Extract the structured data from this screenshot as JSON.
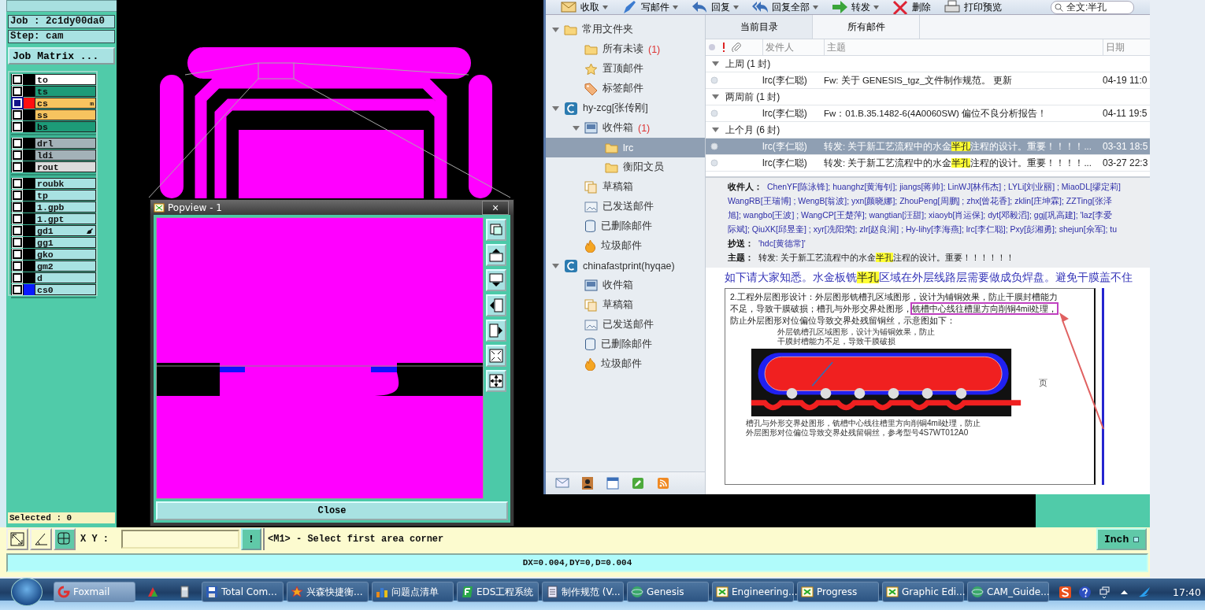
{
  "genesis": {
    "job": "Job : 2c1dy00da0",
    "step": "Step: cam",
    "matrix_button": "Job Matrix ...",
    "layer_groups": [
      {
        "layers": [
          {
            "name": "to",
            "color": "#ffffff",
            "selected": false,
            "flagged": false
          },
          {
            "name": "ts",
            "color": "#1d9b78",
            "selected": false,
            "flagged": false
          },
          {
            "name": "cs",
            "color": "#f7c35f",
            "selected": true,
            "flagged": false,
            "swatch": {
              "color": "#ff1010"
            },
            "mark": "m"
          },
          {
            "name": "ss",
            "color": "#f7c35f",
            "selected": false,
            "flagged": false
          },
          {
            "name": "bs",
            "color": "#1d9b78",
            "selected": false,
            "flagged": false
          }
        ]
      },
      {
        "layers": [
          {
            "name": "drl",
            "color": "#a3b2b8",
            "selected": false,
            "flagged": false
          },
          {
            "name": "ldi",
            "color": "#a3b2b8",
            "selected": false,
            "flagged": false
          },
          {
            "name": "rout",
            "color": "#dcdcdc",
            "selected": false,
            "flagged": false
          }
        ]
      },
      {
        "layers": [
          {
            "name": "roubk",
            "color": "#a8e2e2",
            "selected": false,
            "flagged": false
          },
          {
            "name": "tp",
            "color": "#a8e2e2",
            "selected": false,
            "flagged": false
          },
          {
            "name": "1.gpb",
            "color": "#a8e2e2",
            "selected": false,
            "flagged": false
          },
          {
            "name": "1.gpt",
            "color": "#a8e2e2",
            "selected": false,
            "flagged": false
          },
          {
            "name": "gd1",
            "color": "#a8e2e2",
            "selected": false,
            "flagged": true
          },
          {
            "name": "gg1",
            "color": "#a8e2e2",
            "selected": false,
            "flagged": false
          },
          {
            "name": "gko",
            "color": "#a8e2e2",
            "selected": false,
            "flagged": false
          },
          {
            "name": "gm2",
            "color": "#a8e2e2",
            "selected": false,
            "flagged": false
          },
          {
            "name": "d",
            "color": "#a8e2e2",
            "selected": false,
            "flagged": false
          },
          {
            "name": "cs0",
            "color": "#a8e2e2",
            "selected": false,
            "flagged": false,
            "swatch": {
              "color": "#0a1aff"
            }
          }
        ]
      }
    ],
    "selected_count": "Selected : 0",
    "tool_buttons": [
      {
        "kind": "resize"
      },
      {
        "kind": "measure"
      },
      {
        "kind": "grid"
      }
    ],
    "xy_label": "X Y :",
    "alert_button": "!",
    "prompt": "<M1> - Select first area corner",
    "units": "Inch",
    "status": "DX=0.004,DY=0,D=0.004"
  },
  "popview": {
    "title": "Popview - 1",
    "close_glyph": "×",
    "tools": [
      {
        "kind": "layers"
      },
      {
        "kind": "up"
      },
      {
        "kind": "down"
      },
      {
        "kind": "left"
      },
      {
        "kind": "right"
      },
      {
        "kind": "shrink"
      },
      {
        "kind": "expand"
      }
    ],
    "close_button": "Close"
  },
  "foxmail": {
    "toolbar": [
      {
        "label": "收取",
        "kind": "receive",
        "menu": true
      },
      {
        "label": "写邮件",
        "kind": "compose",
        "menu": true
      },
      {
        "label": "回复",
        "kind": "reply",
        "menu": true
      },
      {
        "label": "回复全部",
        "kind": "reply_all",
        "menu": true
      },
      {
        "label": "转发",
        "kind": "forward",
        "menu": true
      },
      {
        "label": "删除",
        "kind": "delete",
        "menu": false
      },
      {
        "label": "打印预览",
        "kind": "print",
        "menu": false
      }
    ],
    "search": {
      "value": "全文:半孔"
    },
    "folders": [
      {
        "label": "常用文件夹",
        "kind": "folder",
        "selected": false,
        "expanded": true,
        "children": [
          {
            "label": "所有未读",
            "count": "(1)",
            "kind": "folder",
            "selected": false
          },
          {
            "label": "置顶邮件",
            "kind": "star",
            "selected": false
          },
          {
            "label": "标签邮件",
            "kind": "tag",
            "selected": false
          }
        ]
      },
      {
        "label": "hy-zcg[张传刚]",
        "kind": "account",
        "selected": false,
        "expanded": true,
        "children": [
          {
            "label": "收件箱",
            "count": "(1)",
            "kind": "inbox",
            "selected": false,
            "expanded": true,
            "children": [
              {
                "label": "lrc",
                "kind": "folder",
                "selected": true
              },
              {
                "label": "衡阳文员",
                "kind": "folder",
                "selected": false
              }
            ]
          },
          {
            "label": "草稿箱",
            "kind": "drafts",
            "selected": false
          },
          {
            "label": "已发送邮件",
            "kind": "sent",
            "selected": false
          },
          {
            "label": "已删除邮件",
            "kind": "trash",
            "selected": false
          },
          {
            "label": "垃圾邮件",
            "kind": "junk",
            "selected": false
          }
        ]
      },
      {
        "label": "chinafastprint(hyqae)",
        "kind": "account",
        "selected": false,
        "expanded": true,
        "children": [
          {
            "label": "收件箱",
            "kind": "inbox",
            "selected": false
          },
          {
            "label": "草稿箱",
            "kind": "drafts",
            "selected": false
          },
          {
            "label": "已发送邮件",
            "kind": "sent",
            "selected": false
          },
          {
            "label": "已删除邮件",
            "kind": "trash",
            "selected": false
          },
          {
            "label": "垃圾邮件",
            "kind": "junk",
            "selected": false
          }
        ]
      }
    ],
    "bottom_tools": [
      {
        "kind": "mail"
      },
      {
        "kind": "contacts"
      },
      {
        "kind": "calendar"
      },
      {
        "kind": "notes"
      },
      {
        "kind": "rss"
      }
    ],
    "tabs": [
      {
        "label": "当前目录",
        "selected": true
      },
      {
        "label": "所有邮件",
        "selected": false
      }
    ],
    "columns": [
      "发件人",
      "主题",
      "日期"
    ],
    "groups": [
      {
        "label": "上周 (1 封)",
        "expanded": true,
        "messages": [
          {
            "from": "lrc(李仁聪)",
            "subject": [
              {
                "text": "Fw: 关于 GENESIS_tgz_文件制作规范。 更新",
                "highlighted": false
              }
            ],
            "date": "04-19 11:0",
            "selected": false
          }
        ]
      },
      {
        "label": "两周前 (1 封)",
        "expanded": true,
        "messages": [
          {
            "from": "lrc(李仁聪)",
            "subject": [
              {
                "text": "Fw：01.B.35.1482-6(4A0060SW)  偏位不良分析报告！",
                "highlighted": false
              }
            ],
            "date": "04-11 19:5",
            "selected": false
          }
        ]
      },
      {
        "label": "上个月 (6 封)",
        "expanded": true,
        "messages": [
          {
            "from": "lrc(李仁聪)",
            "subject": [
              {
                "text": "转发: 关于新工艺流程中的水金",
                "highlighted": false
              },
              {
                "text": "半孔",
                "highlighted": true
              },
              {
                "text": "注程的设计。重要！！！！...",
                "highlighted": false
              }
            ],
            "date": "03-31 18:5",
            "selected": true
          },
          {
            "from": "lrc(李仁聪)",
            "subject": [
              {
                "text": "转发: 关于新工艺流程中的水金",
                "highlighted": false
              },
              {
                "text": "半孔",
                "highlighted": true
              },
              {
                "text": "注程的设计。重要！！！！...",
                "highlighted": false
              }
            ],
            "date": "03-27 22:3",
            "selected": false
          }
        ]
      }
    ],
    "preview": {
      "to_label": "收件人：",
      "to_lines": [
        "ChenYF[陈泳锋]; huanghz[黄海钊]; jiangs[蒋帅]; LinWJ[林伟杰] ; LYLi[刘业丽] ; MiaoDL[缪定莉]",
        "WangRB[王瑞博] ; WengB[翁波]; yxn[颜晓娜]; ZhouPeng[周鹏] ; zhx[曾花香]; zklin[庄坤霖]; ZZTing[张泽",
        "旭]; wangbo[王波] ; WangCP[王楚萍]; wangtian[汪甜]; xiaoyb[肖运保]; dyt[邓毅滔]; ggj[巩高建]; 'laz[李爱",
        "际斌]; QiuXK[邱昱奎] ; xyr[冼阳荣]; zlr[赵良润] ; Hy-lihy[李海燕]; lrc[李仁聪]; Pxy[彭湘勇]; shejun[佘军]; tu"
      ],
      "cc_label": "抄送：",
      "cc": "'hdc[黄德常]'",
      "subject_label": "主题：",
      "subject": [
        {
          "text": "转发: 关于新工艺流程中的水金",
          "highlighted": false
        },
        {
          "text": "半孔",
          "highlighted": true
        },
        {
          "text": "注程的设计。重要！！！！！！",
          "highlighted": false
        }
      ],
      "intro": [
        {
          "text": "如下请大家知悉。水金板铣",
          "highlighted": false
        },
        {
          "text": "半孔",
          "highlighted": true
        },
        {
          "text": "区域在外层线路层需要做成负焊盘。避免干膜盖不住",
          "highlighted": false
        }
      ],
      "doc_lines": [
        [
          {
            "text": "2.工程外层图形设计：外层图形铣槽孔区域图形，设计为铺铜效果，防止干膜封槽能力",
            "boxed": false
          }
        ],
        [
          {
            "text": "不足，导致干膜破损；槽孔与外形交界处图形，",
            "boxed": false
          },
          {
            "text": "铣槽中心线往槽里方向削铜4mil处理，",
            "boxed": true
          }
        ],
        [
          {
            "text": "防止外层图形对位偏位导致交界处残留铜丝，示意图如下：",
            "boxed": false
          }
        ]
      ],
      "caption_top": [
        "外层铣槽孔区域图形，设计为铺铜效果，防止",
        "干膜封槽能力不足，导致干膜破损"
      ],
      "side_note": "页",
      "caption_bottom": [
        "槽孔与外形交界处图形，铣槽中心线往槽里方向削铜4mil处理，防止",
        "外层图形对位偏位导致交界处残留铜丝，参考型号4S7WT012A0"
      ]
    }
  },
  "taskbar": {
    "items": [
      {
        "label": "Foxmail",
        "kind": "foxmail",
        "active": true
      },
      {
        "kind": "app"
      },
      {
        "kind": "calculator"
      },
      {
        "label": "Total Com...",
        "kind": "disk",
        "active": false
      },
      {
        "label": "兴森快捷衡...",
        "kind": "star",
        "active": false
      },
      {
        "label": "问题点清单",
        "kind": "chart",
        "active": false
      },
      {
        "label": "EDS工程系统",
        "kind": "green",
        "active": false
      },
      {
        "label": "制作规范 (V...",
        "kind": "doc",
        "active": false
      },
      {
        "label": "Genesis",
        "kind": "globe",
        "active": false
      },
      {
        "label": "Engineering...",
        "kind": "window",
        "active": false
      },
      {
        "label": "Progress",
        "kind": "window",
        "active": false
      },
      {
        "label": "Graphic Edi...",
        "kind": "window",
        "active": false
      },
      {
        "label": "CAM_Guide...",
        "kind": "globe",
        "active": false
      }
    ],
    "tray": [
      {
        "kind": "sogou"
      },
      {
        "kind": "help"
      },
      {
        "kind": "restore"
      },
      {
        "kind": "up"
      },
      {
        "kind": "bird"
      }
    ],
    "clock": "17:40"
  }
}
